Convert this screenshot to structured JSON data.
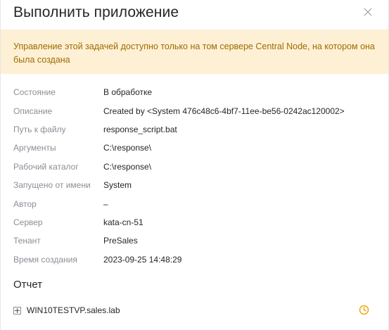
{
  "dialog": {
    "title": "Выполнить приложение"
  },
  "warning": {
    "text": "Управление этой задачей доступно только на том сервере Central Node, на котором она была создана"
  },
  "properties": [
    {
      "label": "Состояние",
      "value": "В обработке"
    },
    {
      "label": "Описание",
      "value": "Created by <System 476c48c6-4bf7-11ee-be56-0242ac120002>"
    },
    {
      "label": "Путь к файлу",
      "value": "response_script.bat"
    },
    {
      "label": "Аргументы",
      "value": "C:\\response\\"
    },
    {
      "label": "Рабочий каталог",
      "value": "C:\\response\\"
    },
    {
      "label": "Запущено от имени",
      "value": "System"
    },
    {
      "label": "Автор",
      "value": "–"
    },
    {
      "label": "Сервер",
      "value": "kata-cn-51"
    },
    {
      "label": "Тенант",
      "value": "PreSales"
    },
    {
      "label": "Время создания",
      "value": "2023-09-25 14:48:29"
    }
  ],
  "report": {
    "title": "Отчет",
    "items": [
      {
        "label": "WIN10TESTVP.sales.lab",
        "status_icon": "clock-icon"
      }
    ]
  },
  "colors": {
    "warning_bg": "#fdf0d5",
    "warning_text": "#a06a00",
    "pending_icon": "#f0a500"
  }
}
